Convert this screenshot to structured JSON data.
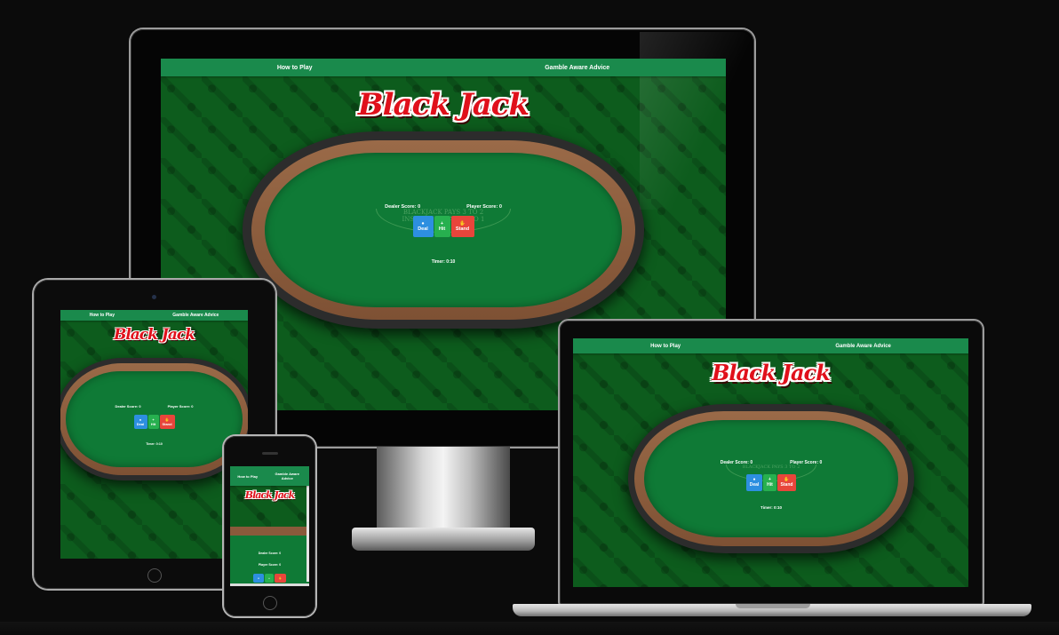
{
  "nav": {
    "how_to_play": "How to Play",
    "gamble_aware": "Gamble Aware Advice"
  },
  "logo": "Black Jack",
  "table": {
    "felt_text_line1": "BLACKJACK PAYS 3 TO 2",
    "felt_text_line2": "INSURANCE PAYS 2 TO 1"
  },
  "scores": {
    "dealer": "Dealer Score: 0",
    "player": "Player Score: 0"
  },
  "buttons": {
    "deal": "Deal",
    "hit": "Hit",
    "stand": "Stand"
  },
  "icons": {
    "deal": "user-icon",
    "hit": "plus-icon",
    "stand": "hand-icon"
  },
  "timer": "Timer: 0:10",
  "colors": {
    "navbar": "#1a8a4c",
    "felt": "#0f7a36",
    "deal_button": "#2d8fe0",
    "hit_button": "#27b04f",
    "stand_button": "#e8453b",
    "logo": "#e0101b"
  }
}
